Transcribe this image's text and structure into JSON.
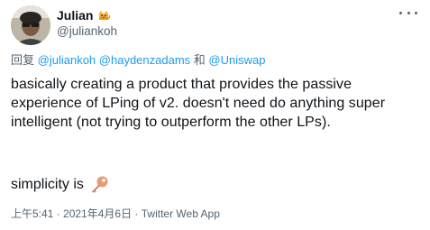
{
  "author": {
    "display_name": "Julian",
    "handle": "@juliankoh",
    "badge_icon": "cat-icon",
    "avatar_icon": "avatar-photo"
  },
  "reply": {
    "prefix": "回复",
    "mentions": [
      "@juliankoh",
      "@haydenzadams"
    ],
    "conjunction": "和",
    "last_mention": "@Uniswap"
  },
  "body": {
    "paragraph1": "basically creating a product that provides the passive experience of LPing of v2.  doesn't need do anything super intelligent (not trying to outperform the other LPs).",
    "paragraph2": "simplicity is",
    "emoji": "key-icon"
  },
  "meta": {
    "time": "上午5:41",
    "separator": " · ",
    "date": "2021年4月6日",
    "source": "Twitter Web App"
  },
  "colors": {
    "link": "#1d9bf0",
    "secondary_text": "#536471",
    "primary_text": "#0f1419"
  }
}
